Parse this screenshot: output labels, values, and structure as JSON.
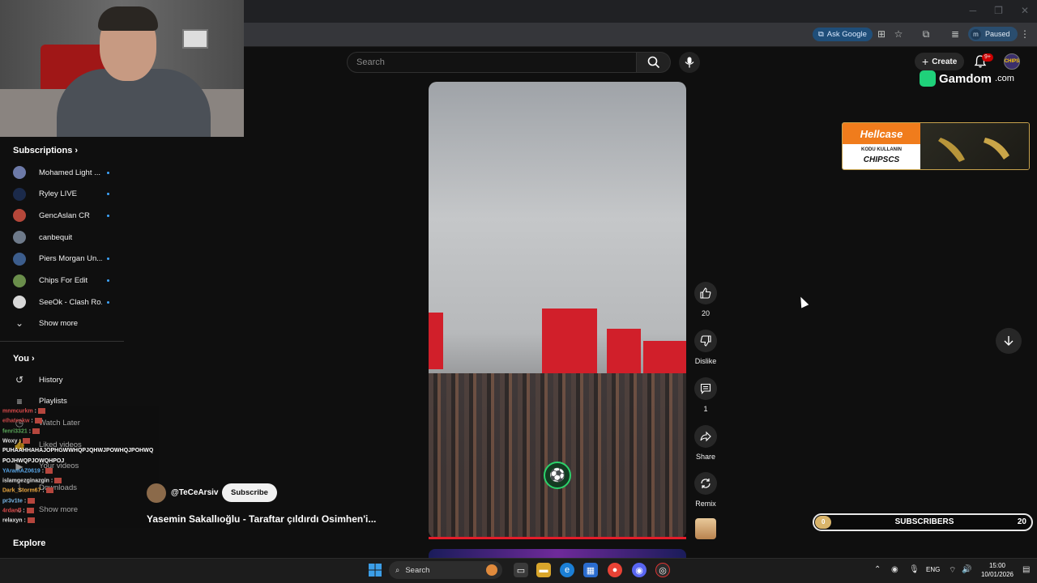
{
  "browser": {
    "ask_google_label": "Ask Google",
    "profile_label": "Paused",
    "profile_initial": "m",
    "min_glyph": "─",
    "max_glyph": "❐",
    "close_glyph": "✕"
  },
  "youtube": {
    "search_placeholder": "Search",
    "create_label": "Create",
    "notif_count": "9+",
    "avatar_text": "CHIPS"
  },
  "overlays": {
    "gamdom_text": "Gamdom",
    "gamdom_suffix": ".com",
    "hellcase_brand": "Hellcase",
    "hellcase_code_label": "KODU KULLANIN",
    "hellcase_code": "CHIPSCS"
  },
  "sidebar": {
    "subscriptions_label": "Subscriptions",
    "subscriptions": [
      {
        "label": "Mohamed Light ...",
        "color": "#6d7aa8"
      },
      {
        "label": "Ryley LIVE",
        "color": "#1b2a4a"
      },
      {
        "label": "GencAslan CR",
        "color": "#b5473a"
      },
      {
        "label": "canbequit",
        "color": "#6e7a8a"
      },
      {
        "label": "Piers Morgan Un...",
        "color": "#3c5d8c"
      },
      {
        "label": "Chips For Edit",
        "color": "#6a8e4b"
      },
      {
        "label": "SeeOk - Clash Ro...",
        "color": "#d8d8d8"
      }
    ],
    "show_more": "Show more",
    "you_label": "You",
    "you_items": [
      {
        "label": "History",
        "icon": "↺"
      },
      {
        "label": "Playlists",
        "icon": "≡"
      },
      {
        "label": "Watch Later",
        "icon": "◷"
      },
      {
        "label": "Liked videos",
        "icon": "👍"
      },
      {
        "label": "Your videos",
        "icon": "▶"
      },
      {
        "label": "Downloads",
        "icon": "⤓"
      }
    ],
    "show_more_2": "Show more",
    "explore_label": "Explore"
  },
  "chat": [
    {
      "user": "mnmcurkm",
      "color": "#d94a4a",
      "msg": " :"
    },
    {
      "user": "eIhateskw",
      "color": "#c94848",
      "msg": " :"
    },
    {
      "user": "fenri3321",
      "color": "#5aa85a",
      "msg": " :"
    },
    {
      "user": "Woxy",
      "color": "#e0e0e0",
      "msg": " :"
    },
    {
      "user": "",
      "color": "#ffffff",
      "msg": "PUHAAHHAHAJOPHGWWHQPJQHWJPOWHQJPOHWQ"
    },
    {
      "user": "",
      "color": "#ffffff",
      "msg": "POJHWQPJOWQHPOJ"
    },
    {
      "user": "YAramAZ0619",
      "color": "#58a6e8",
      "msg": " :"
    },
    {
      "user": "islamgezginazgin",
      "color": "#e0e0e0",
      "msg": " :"
    },
    {
      "user": "Dark_Storm67",
      "color": "#e8a640",
      "msg": " :"
    },
    {
      "user": "pr3v1te",
      "color": "#7ab8e8",
      "msg": " :"
    },
    {
      "user": "4rdanfl",
      "color": "#d94a4a",
      "msg": " :"
    },
    {
      "user": "relaxyn",
      "color": "#e0e0e0",
      "msg": " :"
    }
  ],
  "video": {
    "channel": "@TeCeArsiv",
    "subscribe_label": "Subscribe",
    "title": "Yasemin Sakallıoğlu - Taraftar çıldırdı Osimhen'i...",
    "like_count": "20",
    "dislike_label": "Dislike",
    "comment_count": "1",
    "share_label": "Share",
    "remix_label": "Remix",
    "progress_fraction": 1.0
  },
  "sub_goal": {
    "label": "SUBSCRIBERS",
    "current": "0",
    "target": "20",
    "progress_fraction": 0.0
  },
  "taskbar": {
    "search_label": "Search",
    "lang": "ENG",
    "time": "15:00",
    "date": "10/01/2026"
  }
}
